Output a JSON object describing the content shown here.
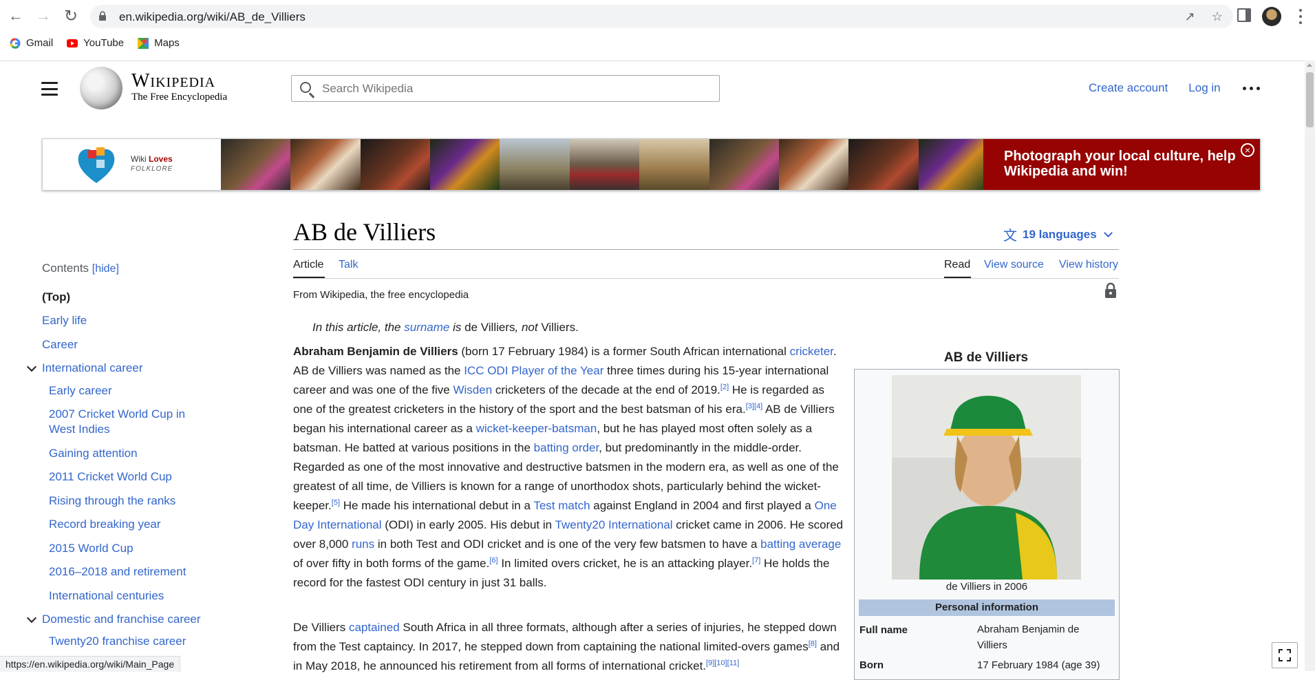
{
  "browser": {
    "url": "en.wikipedia.org/wiki/AB_de_Villiers",
    "bookmarks": [
      {
        "label": "Gmail",
        "icon": "google-icon"
      },
      {
        "label": "YouTube",
        "icon": "youtube-icon"
      },
      {
        "label": "Maps",
        "icon": "maps-icon"
      }
    ],
    "status_url": "https://en.wikipedia.org/wiki/Main_Page"
  },
  "header": {
    "wordmark": "Wikipedia",
    "tagline": "The Free Encyclopedia",
    "search_placeholder": "Search Wikipedia",
    "create_account": "Create account",
    "log_in": "Log in"
  },
  "banner": {
    "logo_line1_prefix": "Wiki ",
    "logo_line1_bold": "Loves",
    "logo_line2": "FOLKLORE",
    "cta": "Photograph your local culture, help Wikipedia and win!"
  },
  "toc": {
    "title": "Contents",
    "hide": "[hide]",
    "items": [
      "(Top)",
      "Early life",
      "Career",
      "International career",
      "Early career",
      "2007 Cricket World Cup in West Indies",
      "Gaining attention",
      "2011 Cricket World Cup",
      "Rising through the ranks",
      "Record breaking year",
      "2015 World Cup",
      "2016–2018 and retirement",
      "International centuries",
      "Domestic and franchise career",
      "Twenty20 franchise career"
    ]
  },
  "article": {
    "title": "AB de Villiers",
    "languages": "19 languages",
    "tabs": {
      "article": "Article",
      "talk": "Talk",
      "read": "Read",
      "view_source": "View source",
      "view_history": "View history"
    },
    "from": "From Wikipedia, the free encyclopedia",
    "hatnote": {
      "pre": "In this article, the ",
      "link": "surname",
      "mid": " is ",
      "name": "de Villiers",
      "comma": ", ",
      "not": "not",
      "post": " Villiers."
    },
    "p1": {
      "bold": "Abraham Benjamin de Villiers",
      "t1": " (born 17 February 1984) is a former South African international ",
      "l1": "cricketer",
      "t2": ". AB de Villiers was named as the ",
      "l2": "ICC ODI Player of the Year",
      "t3": " three times during his 15-year international career and was one of the five ",
      "l3": "Wisden",
      "t4": " cricketers of the decade at the end of 2019.",
      "r1": "[2]",
      "t5": " He is regarded as one of the greatest cricketers in the history of the sport and the best batsman of his era.",
      "r2": "[3]",
      "r3": "[4]",
      "t6": " AB de Villiers began his international career as a ",
      "l4": "wicket-keeper-batsman",
      "t7": ", but he has played most often solely as a batsman. He batted at various positions in the ",
      "l5": "batting order",
      "t8": ", but predominantly in the middle-order. Regarded as one of the most innovative and destructive batsmen in the modern era, as well as one of the greatest of all time, de Villiers is known for a range of unorthodox shots, particularly behind the wicket-keeper.",
      "r4": "[5]",
      "t9": " He made his international debut in a ",
      "l6": "Test match",
      "t10": " against England in 2004 and first played a ",
      "l7": "One Day International",
      "t11": " (ODI) in early 2005. His debut in ",
      "l8": "Twenty20 International",
      "t12": " cricket came in 2006. He scored over 8,000 ",
      "l9": "runs",
      "t13": " in both Test and ODI cricket and is one of the very few batsmen to have a ",
      "l10": "batting average",
      "t14": " of over fifty in both forms of the game.",
      "r5": "[6]",
      "t15": " In limited overs cricket, he is an attacking player.",
      "r6": "[7]",
      "t16": " He holds the record for the fastest ODI century in just 31 balls."
    },
    "p2": {
      "t1": "De Villiers ",
      "l1": "captained",
      "t2": " South Africa in all three formats, although after a series of injuries, he stepped down from the Test captaincy. In 2017, he stepped down from captaining the national limited-overs games",
      "r1": "[8]",
      "t3": " and in May 2018, he announced his retirement from all forms of international cricket.",
      "r2": "[9]",
      "r3": "[10]",
      "r4": "[11]"
    }
  },
  "infobox": {
    "title": "AB de Villiers",
    "caption": "de Villiers in 2006",
    "section": "Personal information",
    "rows": [
      {
        "label": "Full name",
        "value": "Abraham Benjamin de Villiers"
      },
      {
        "label": "Born",
        "value": "17 February 1984 (age 39)"
      }
    ]
  }
}
